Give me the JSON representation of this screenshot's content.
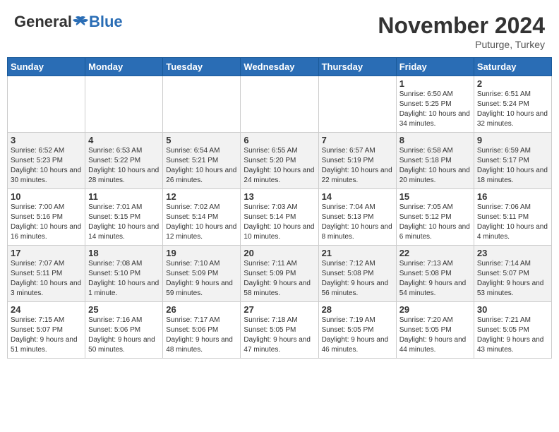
{
  "header": {
    "logo_general": "General",
    "logo_blue": "Blue",
    "month": "November 2024",
    "location": "Puturge, Turkey"
  },
  "days_of_week": [
    "Sunday",
    "Monday",
    "Tuesday",
    "Wednesday",
    "Thursday",
    "Friday",
    "Saturday"
  ],
  "weeks": [
    [
      {
        "day": "",
        "info": ""
      },
      {
        "day": "",
        "info": ""
      },
      {
        "day": "",
        "info": ""
      },
      {
        "day": "",
        "info": ""
      },
      {
        "day": "",
        "info": ""
      },
      {
        "day": "1",
        "info": "Sunrise: 6:50 AM\nSunset: 5:25 PM\nDaylight: 10 hours and 34 minutes."
      },
      {
        "day": "2",
        "info": "Sunrise: 6:51 AM\nSunset: 5:24 PM\nDaylight: 10 hours and 32 minutes."
      }
    ],
    [
      {
        "day": "3",
        "info": "Sunrise: 6:52 AM\nSunset: 5:23 PM\nDaylight: 10 hours and 30 minutes."
      },
      {
        "day": "4",
        "info": "Sunrise: 6:53 AM\nSunset: 5:22 PM\nDaylight: 10 hours and 28 minutes."
      },
      {
        "day": "5",
        "info": "Sunrise: 6:54 AM\nSunset: 5:21 PM\nDaylight: 10 hours and 26 minutes."
      },
      {
        "day": "6",
        "info": "Sunrise: 6:55 AM\nSunset: 5:20 PM\nDaylight: 10 hours and 24 minutes."
      },
      {
        "day": "7",
        "info": "Sunrise: 6:57 AM\nSunset: 5:19 PM\nDaylight: 10 hours and 22 minutes."
      },
      {
        "day": "8",
        "info": "Sunrise: 6:58 AM\nSunset: 5:18 PM\nDaylight: 10 hours and 20 minutes."
      },
      {
        "day": "9",
        "info": "Sunrise: 6:59 AM\nSunset: 5:17 PM\nDaylight: 10 hours and 18 minutes."
      }
    ],
    [
      {
        "day": "10",
        "info": "Sunrise: 7:00 AM\nSunset: 5:16 PM\nDaylight: 10 hours and 16 minutes."
      },
      {
        "day": "11",
        "info": "Sunrise: 7:01 AM\nSunset: 5:15 PM\nDaylight: 10 hours and 14 minutes."
      },
      {
        "day": "12",
        "info": "Sunrise: 7:02 AM\nSunset: 5:14 PM\nDaylight: 10 hours and 12 minutes."
      },
      {
        "day": "13",
        "info": "Sunrise: 7:03 AM\nSunset: 5:14 PM\nDaylight: 10 hours and 10 minutes."
      },
      {
        "day": "14",
        "info": "Sunrise: 7:04 AM\nSunset: 5:13 PM\nDaylight: 10 hours and 8 minutes."
      },
      {
        "day": "15",
        "info": "Sunrise: 7:05 AM\nSunset: 5:12 PM\nDaylight: 10 hours and 6 minutes."
      },
      {
        "day": "16",
        "info": "Sunrise: 7:06 AM\nSunset: 5:11 PM\nDaylight: 10 hours and 4 minutes."
      }
    ],
    [
      {
        "day": "17",
        "info": "Sunrise: 7:07 AM\nSunset: 5:11 PM\nDaylight: 10 hours and 3 minutes."
      },
      {
        "day": "18",
        "info": "Sunrise: 7:08 AM\nSunset: 5:10 PM\nDaylight: 10 hours and 1 minute."
      },
      {
        "day": "19",
        "info": "Sunrise: 7:10 AM\nSunset: 5:09 PM\nDaylight: 9 hours and 59 minutes."
      },
      {
        "day": "20",
        "info": "Sunrise: 7:11 AM\nSunset: 5:09 PM\nDaylight: 9 hours and 58 minutes."
      },
      {
        "day": "21",
        "info": "Sunrise: 7:12 AM\nSunset: 5:08 PM\nDaylight: 9 hours and 56 minutes."
      },
      {
        "day": "22",
        "info": "Sunrise: 7:13 AM\nSunset: 5:08 PM\nDaylight: 9 hours and 54 minutes."
      },
      {
        "day": "23",
        "info": "Sunrise: 7:14 AM\nSunset: 5:07 PM\nDaylight: 9 hours and 53 minutes."
      }
    ],
    [
      {
        "day": "24",
        "info": "Sunrise: 7:15 AM\nSunset: 5:07 PM\nDaylight: 9 hours and 51 minutes."
      },
      {
        "day": "25",
        "info": "Sunrise: 7:16 AM\nSunset: 5:06 PM\nDaylight: 9 hours and 50 minutes."
      },
      {
        "day": "26",
        "info": "Sunrise: 7:17 AM\nSunset: 5:06 PM\nDaylight: 9 hours and 48 minutes."
      },
      {
        "day": "27",
        "info": "Sunrise: 7:18 AM\nSunset: 5:05 PM\nDaylight: 9 hours and 47 minutes."
      },
      {
        "day": "28",
        "info": "Sunrise: 7:19 AM\nSunset: 5:05 PM\nDaylight: 9 hours and 46 minutes."
      },
      {
        "day": "29",
        "info": "Sunrise: 7:20 AM\nSunset: 5:05 PM\nDaylight: 9 hours and 44 minutes."
      },
      {
        "day": "30",
        "info": "Sunrise: 7:21 AM\nSunset: 5:05 PM\nDaylight: 9 hours and 43 minutes."
      }
    ]
  ]
}
